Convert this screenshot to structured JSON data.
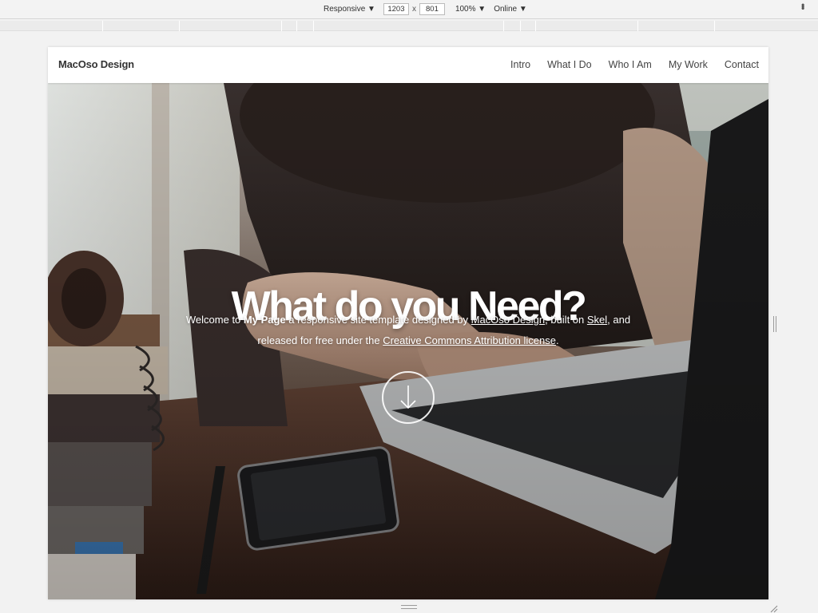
{
  "devtools": {
    "device": "Responsive ▼",
    "width": "1203",
    "height": "801",
    "times": "x",
    "zoom": "100% ▼",
    "network": "Online ▼",
    "menu_icon": "kebab-menu-icon"
  },
  "site": {
    "brand": "MacOso Design",
    "nav": [
      "Intro",
      "What I Do",
      "Who I Am",
      "My Work",
      "Contact"
    ]
  },
  "hero": {
    "headline": "What do you Need?",
    "intro": {
      "p1": "Welcome to ",
      "b1": "My Page",
      "p2": " a responsive site template designed by ",
      "l1": "MacOso Design",
      "p3": ", built on ",
      "l2": "Skel",
      "p4": ", and released for free under the ",
      "l3": "Creative Commons Attribution license",
      "p5": "."
    },
    "scroll_icon": "arrow-down-circle-icon"
  }
}
